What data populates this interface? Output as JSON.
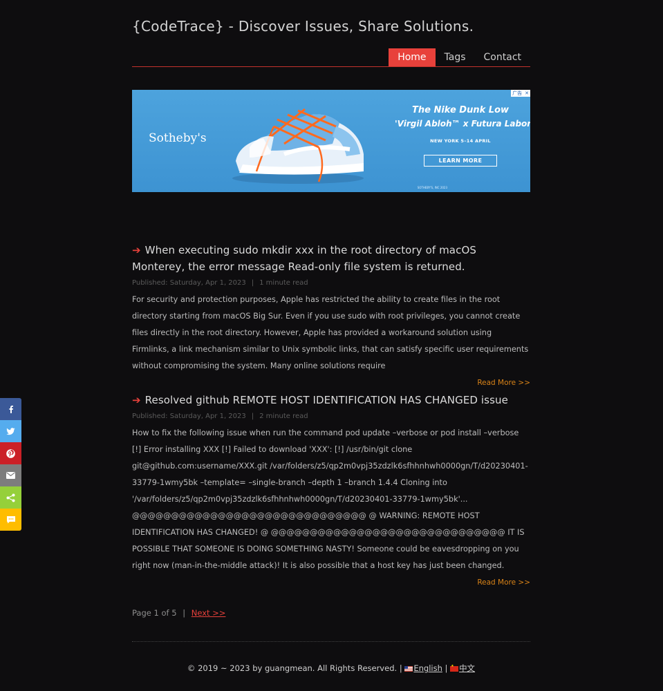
{
  "header": {
    "site_title": "{CodeTrace} - Discover Issues, Share Solutions."
  },
  "nav": {
    "items": [
      {
        "label": "Home",
        "active": true
      },
      {
        "label": "Tags",
        "active": false
      },
      {
        "label": "Contact",
        "active": false
      }
    ]
  },
  "ad": {
    "brand": "Sotheby's",
    "headline1": "The Nike Dunk Low",
    "headline2": "'Virgil Abloh™ x Futura Laboratories'",
    "subline": "NEW YORK 5–14 APRIL",
    "cta": "LEARN MORE",
    "fine_print": "SOTHEBY'S, INC 2023",
    "badge_label": "广告",
    "badge_close": "✕"
  },
  "posts": [
    {
      "title": "When executing sudo mkdir xxx in the root directory of macOS Monterey, the error message Read-only file system is returned.",
      "published": "Published: Saturday, Apr 1, 2023",
      "read_time": "1 minute read",
      "excerpt": "For security and protection purposes, Apple has restricted the ability to create files in the root directory starting from macOS Big Sur. Even if you use sudo with root privileges, you cannot create files directly in the root directory. However, Apple has provided a workaround solution using Firmlinks, a link mechanism similar to Unix symbolic links, that can satisfy specific user requirements without compromising the system. Many online solutions require",
      "read_more": "Read More >>"
    },
    {
      "title": "Resolved github REMOTE HOST IDENTIFICATION HAS CHANGED issue",
      "published": "Published: Saturday, Apr 1, 2023",
      "read_time": "2 minute read",
      "excerpt": "How to fix the following issue when run the command pod update –verbose or pod install –verbose [!] Error installing XXX [!] Failed to download 'XXX': [!] /usr/bin/git clone git@github.com:username/XXX.git /var/folders/z5/qp2m0vpj35zdzlk6sfhhnhwh0000gn/T/d20230401-33779-1wmy5bk –template= –single-branch –depth 1 –branch 1.4.4 Cloning into '/var/folders/z5/qp2m0vpj35zdzlk6sfhhnhwh0000gn/T/d20230401-33779-1wmy5bk'... @@@@@@@@@@@@@@@@@@@@@@@@@@@@@@ @ WARNING: REMOTE HOST IDENTIFICATION HAS CHANGED! @ @@@@@@@@@@@@@@@@@@@@@@@@@@@@@@ IT IS POSSIBLE THAT SOMEONE IS DOING SOMETHING NASTY! Someone could be eavesdropping on you right now (man-in-the-middle attack)! It is also possible that a host key has just been changed.",
      "read_more": "Read More >>"
    }
  ],
  "pagination": {
    "label": "Page 1 of 5",
    "separator": "|",
    "next": "Next >>"
  },
  "footer": {
    "copyright": "© 2019 ~ 2023 by guangmean. All Rights Reserved.",
    "separator": "|",
    "lang_en": "English",
    "lang_zh": "中文"
  },
  "share": [
    {
      "icon": "facebook-icon",
      "color": "#3b5998"
    },
    {
      "icon": "twitter-icon",
      "color": "#55acee"
    },
    {
      "icon": "pinterest-icon",
      "color": "#cb2027"
    },
    {
      "icon": "email-icon",
      "color": "#7d7d7d"
    },
    {
      "icon": "sharethis-icon",
      "color": "#95d03a"
    },
    {
      "icon": "sms-icon",
      "color": "#ffbd00"
    }
  ],
  "colors": {
    "background": "#0e0d0f",
    "accent": "#e8413b",
    "read_more": "#d98318"
  }
}
